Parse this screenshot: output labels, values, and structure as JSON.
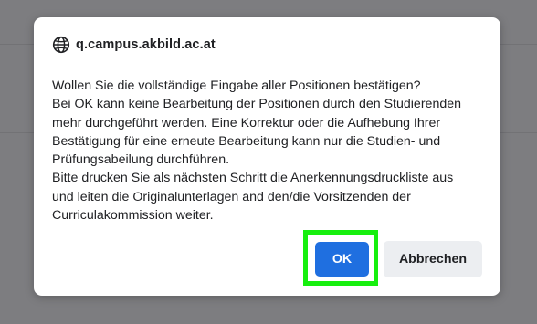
{
  "dialog": {
    "origin": "q.campus.akbild.ac.at",
    "origin_icon": "globe-icon",
    "message_lines": [
      "Wollen Sie die vollständige Eingabe aller Positionen bestätigen?",
      "Bei OK kann keine Bearbeitung der Positionen durch den Studierenden",
      "mehr durchgeführt werden. Eine Korrektur oder die Aufhebung Ihrer",
      "Bestätigung für eine erneute Bearbeitung kann nur die Studien- und",
      "Prüfungsabeilung durchführen.",
      "Bitte drucken Sie als nächsten Schritt die Anerkennungsdruckliste aus",
      "und leiten die Originalunterlagen and den/die Vorsitzenden der",
      "Curriculakommission weiter."
    ],
    "ok_label": "OK",
    "cancel_label": "Abbrechen"
  },
  "colors": {
    "overlay": "#7d7d80",
    "ok_button": "#1f6fe0",
    "cancel_button": "#eceef1",
    "highlight": "#16ef0e"
  }
}
